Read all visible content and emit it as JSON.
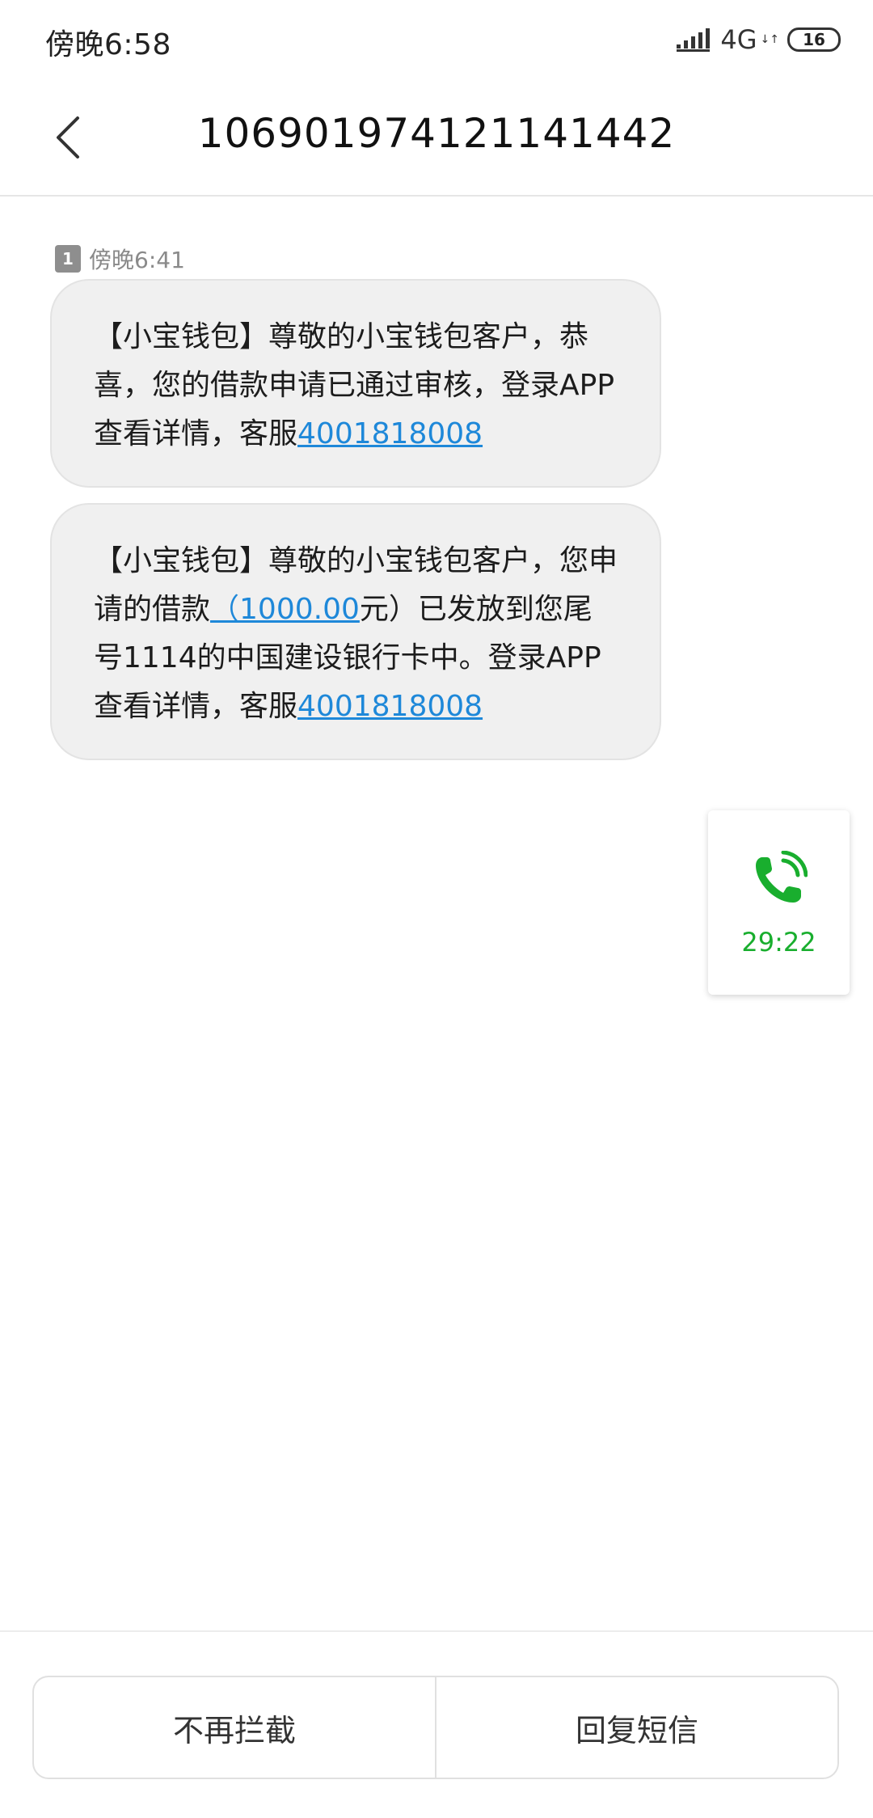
{
  "status_bar": {
    "time": "傍晚6:58",
    "network": "4G",
    "network_arrows": "↓↑",
    "battery": "16"
  },
  "header": {
    "back_icon": "chevron-left-icon",
    "title": "106901974121141442"
  },
  "thread": {
    "sim_slot": "1",
    "timestamp": "傍晚6:41",
    "messages": [
      {
        "prefix": "【小宝钱包】尊敬的小宝钱包客户，恭喜，您的借款申请已通过审核，登录APP查看详情，客服",
        "phone_link": "4001818008"
      },
      {
        "prefix": "【小宝钱包】尊敬的小宝钱包客户，您申请的借款",
        "amount_link": "（1000.00",
        "middle": "元）已发放到您尾号1114的中国建设银行卡中。登录APP查看详情，客服",
        "phone_link": "4001818008"
      }
    ]
  },
  "call_card": {
    "icon": "phone-icon",
    "duration": "29:22"
  },
  "actions": {
    "unblock_label": "不再拦截",
    "reply_label": "回复短信"
  },
  "colors": {
    "link": "#1e88d9",
    "call_green": "#19ae2e",
    "bubble_bg": "#f0f0f0"
  }
}
